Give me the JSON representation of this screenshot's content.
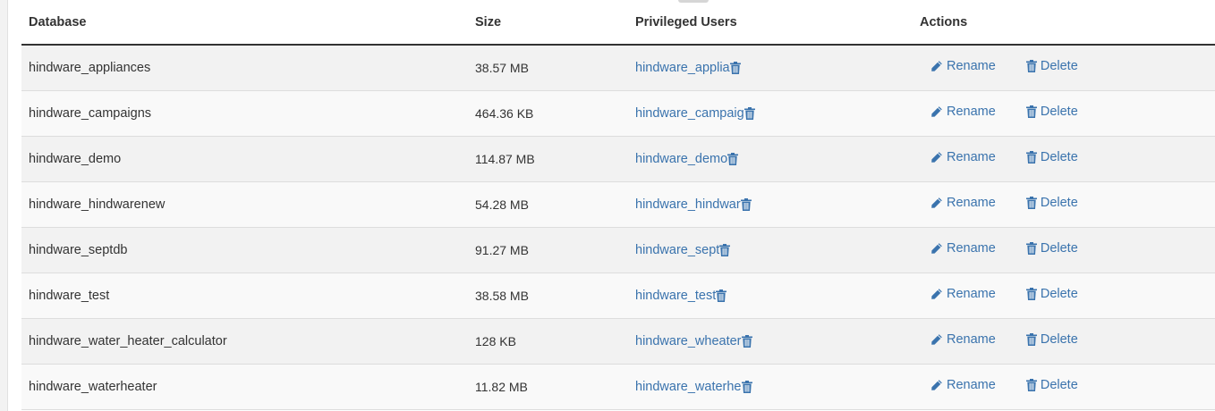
{
  "table": {
    "headers": {
      "database": "Database",
      "size": "Size",
      "users": "Privileged Users",
      "actions": "Actions"
    },
    "rows": [
      {
        "database": "hindware_appliances",
        "size": "38.57 MB",
        "user": "hindware_applia"
      },
      {
        "database": "hindware_campaigns",
        "size": "464.36 KB",
        "user": "hindware_campaig"
      },
      {
        "database": "hindware_demo",
        "size": "114.87 MB",
        "user": "hindware_demo"
      },
      {
        "database": "hindware_hindwarenew",
        "size": "54.28 MB",
        "user": "hindware_hindwar"
      },
      {
        "database": "hindware_septdb",
        "size": "91.27 MB",
        "user": "hindware_sept"
      },
      {
        "database": "hindware_test",
        "size": "38.58 MB",
        "user": "hindware_test"
      },
      {
        "database": "hindware_water_heater_calculator",
        "size": "128 KB",
        "user": "hindware_wheater"
      },
      {
        "database": "hindware_waterheater",
        "size": "11.82 MB",
        "user": "hindware_waterhe"
      }
    ]
  },
  "actions": {
    "rename_label": "Rename",
    "delete_label": "Delete"
  },
  "icons": {
    "rename": "pencil-icon",
    "delete": "trash-icon",
    "revoke_user": "trash-icon"
  },
  "colors": {
    "link": "#3a73ad",
    "text": "#333333",
    "row_odd": "#f2f2f2",
    "row_even": "#f9f9f9"
  }
}
